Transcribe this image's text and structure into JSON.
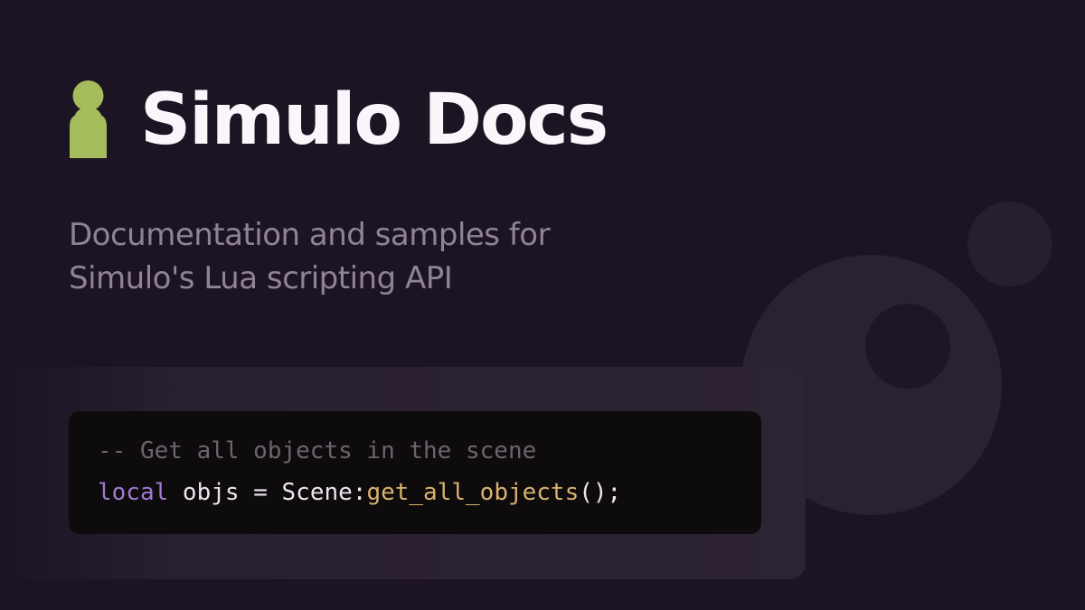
{
  "brand": {
    "title": "Simulo Docs",
    "logo_icon": "person-icon",
    "logo_color": "#a4bc5c"
  },
  "subtitle": {
    "line1": "Documentation and samples for",
    "line2": "Simulo's Lua scripting API"
  },
  "code": {
    "comment": "-- Get all objects in the scene",
    "keyword": "local",
    "assignment": " objs = Scene:",
    "function_name": "get_all_objects",
    "tail": "();"
  },
  "colors": {
    "background": "#1c1323",
    "code_keyword": "#a07ad1",
    "code_function": "#d8b36d",
    "code_comment": "#6b6470"
  }
}
